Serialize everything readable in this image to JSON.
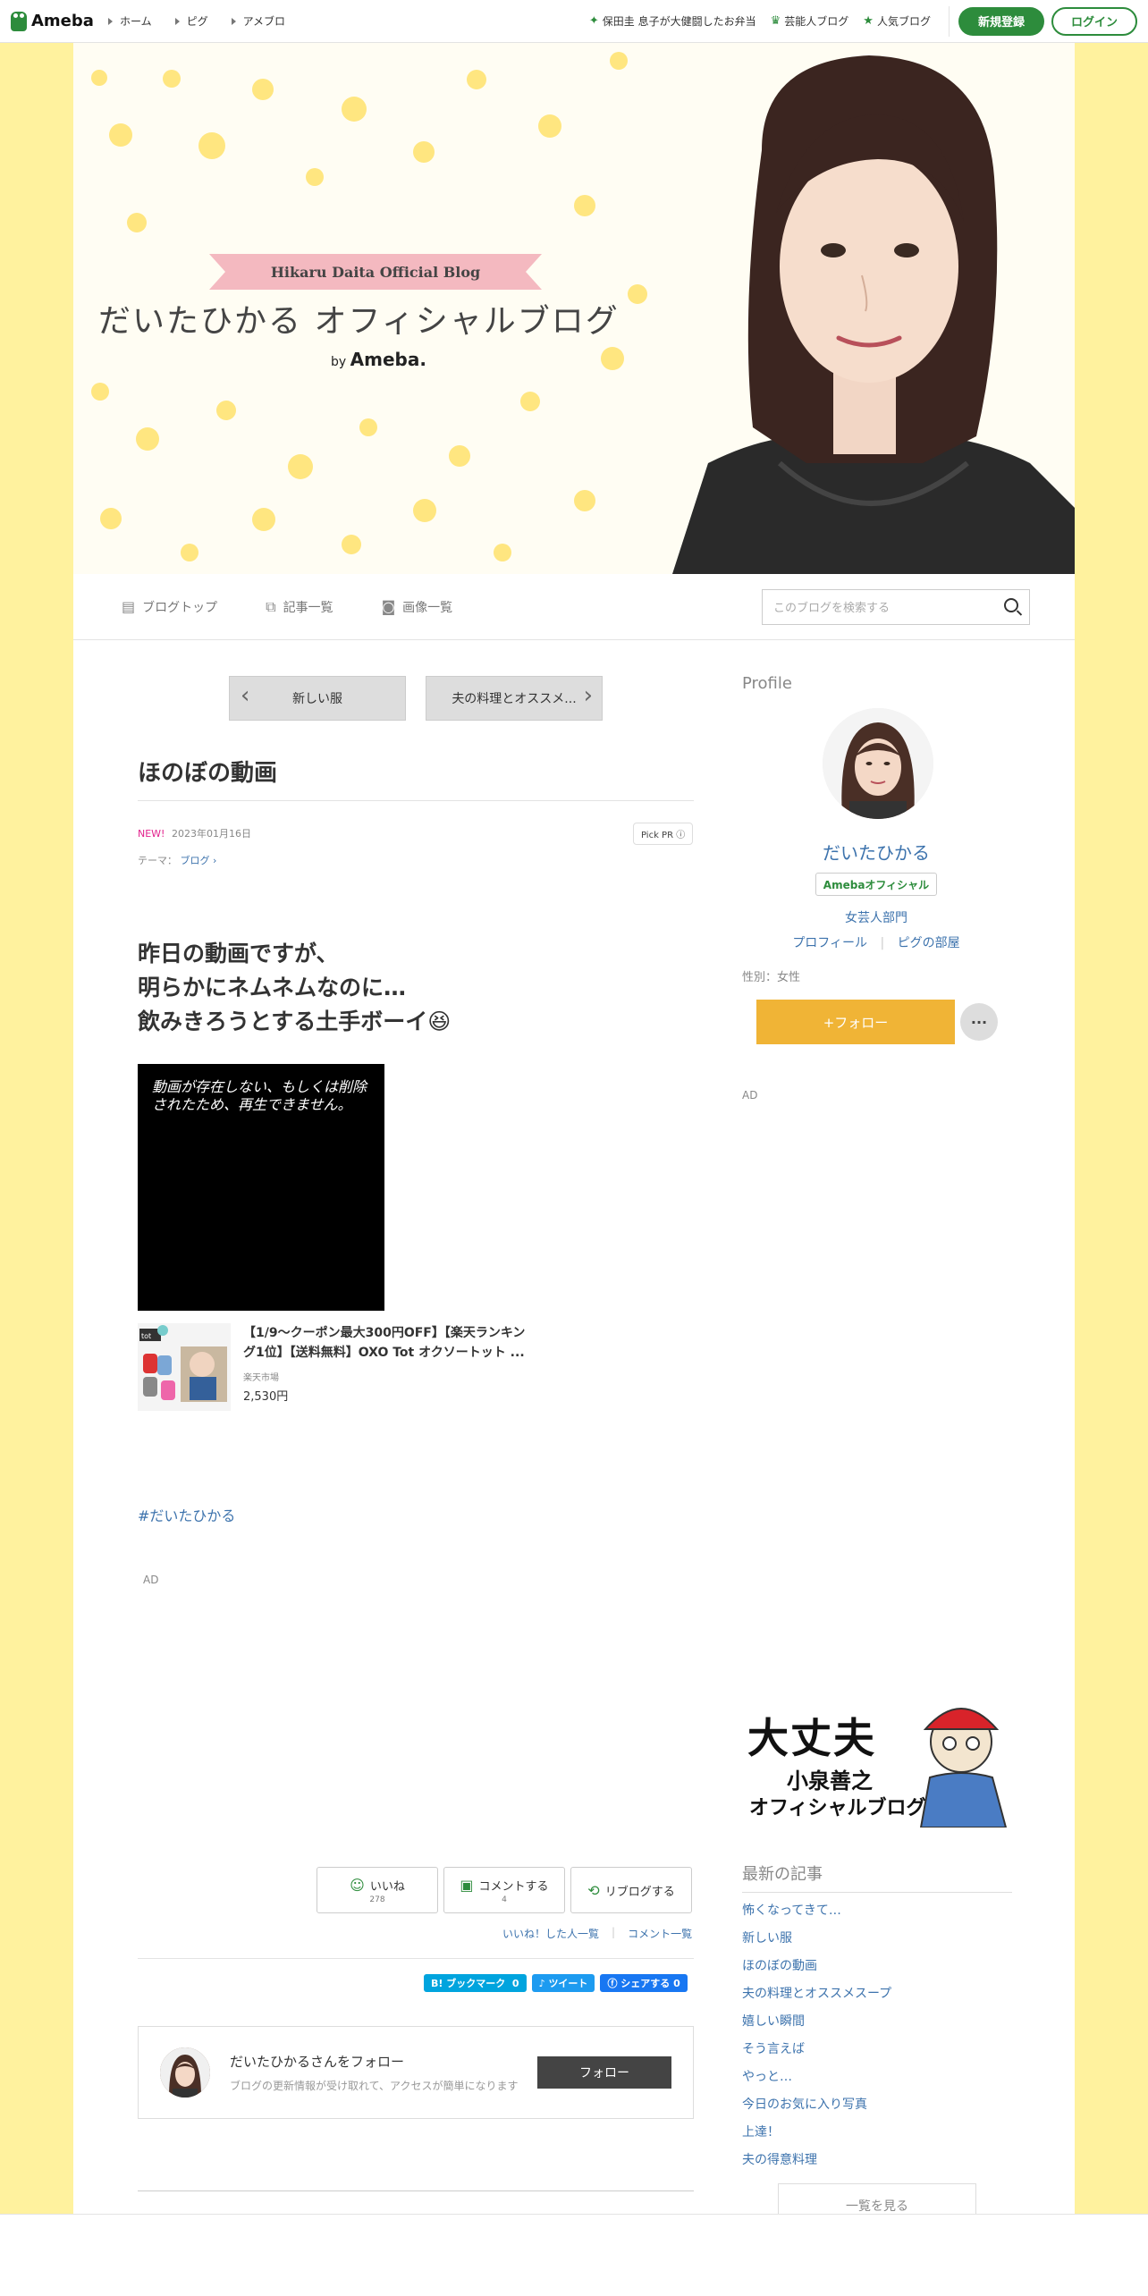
{
  "topbar": {
    "logo": "Ameba",
    "nav": [
      "ホーム",
      "ピグ",
      "アメブロ"
    ],
    "right_links": [
      {
        "icon": "sparkle-icon",
        "label": "保田圭 息子が大健闘したお弁当"
      },
      {
        "icon": "crown-icon",
        "label": "芸能人ブログ"
      },
      {
        "icon": "star-icon",
        "label": "人気ブログ"
      }
    ],
    "signup": "新規登録",
    "login": "ログイン"
  },
  "header": {
    "ribbon": "Hikaru Daita Official Blog",
    "title": "だいたひかる オフィシャルブログ",
    "by": "by",
    "by_brand": "Ameba."
  },
  "subnav": {
    "items": [
      "ブログトップ",
      "記事一覧",
      "画像一覧"
    ],
    "search_placeholder": "このブログを検索する"
  },
  "article": {
    "prev": "新しい服",
    "next": "夫の料理とオススメ...",
    "title": "ほのぼの動画",
    "new_label": "NEW!",
    "date": "2023年01月16日",
    "pick_pr": "Pick PR ⓘ",
    "theme_label": "テーマ：",
    "theme": "ブログ",
    "body_lines": [
      "昨日の動画ですが、",
      "明らかにネムネムなのに…",
      "飲みきろうとする土手ボーイ😆"
    ],
    "video_message": "動画が存在しない、もしくは削除されたため、再生できません。",
    "product": {
      "name": "【1/9～クーポン最大300円OFF】【楽天ランキング1位】【送料無料】OXO Tot オクソートット ...",
      "shop": "楽天市場",
      "price": "2,530円"
    },
    "hashtag": "#だいたひかる",
    "ad_label": "AD",
    "like_label": "いいね",
    "like_count": "278",
    "comment_label": "コメントする",
    "comment_count": "4",
    "reblog_label": "リブログする",
    "liked_list": "いいね！した人一覧",
    "comment_list": "コメント一覧",
    "share_hatena": "B! ブックマーク",
    "share_hatena_count": "0",
    "share_tweet": "ツイート",
    "share_fb": "シェアする",
    "share_fb_count": "0",
    "follow_title": "だいたひかるさんをフォロー",
    "follow_sub": "ブログの更新情報が受け取れて、アクセスが簡単になります",
    "follow_btn": "フォロー"
  },
  "sidebar": {
    "profile_heading": "Profile",
    "name": "だいたひかる",
    "badge": "Amebaオフィシャル",
    "category": "女芸人部門",
    "link_profile": "プロフィール",
    "link_room": "ピグの部屋",
    "gender": "性別：女性",
    "follow": "+フォロー",
    "more": "···",
    "ad_label": "AD",
    "banner_line1": "大丈夫",
    "banner_line2": "小泉善之",
    "banner_line3": "オフィシャルブログ",
    "recent_heading": "最新の記事",
    "recent": [
      "怖くなってきて…",
      "新しい服",
      "ほのぼの動画",
      "夫の料理とオススメスープ",
      "嬉しい瞬間",
      "そう言えば",
      "やっと…",
      "今日のお気に入り写真",
      "上達！",
      "夫の得意料理"
    ],
    "see_all": "一覧を見る"
  },
  "colors": {
    "ameba_green": "#2d8c3c",
    "link_blue": "#3d73ad",
    "follow_orange": "#f0b436",
    "background_yellow": "#fff29e"
  }
}
